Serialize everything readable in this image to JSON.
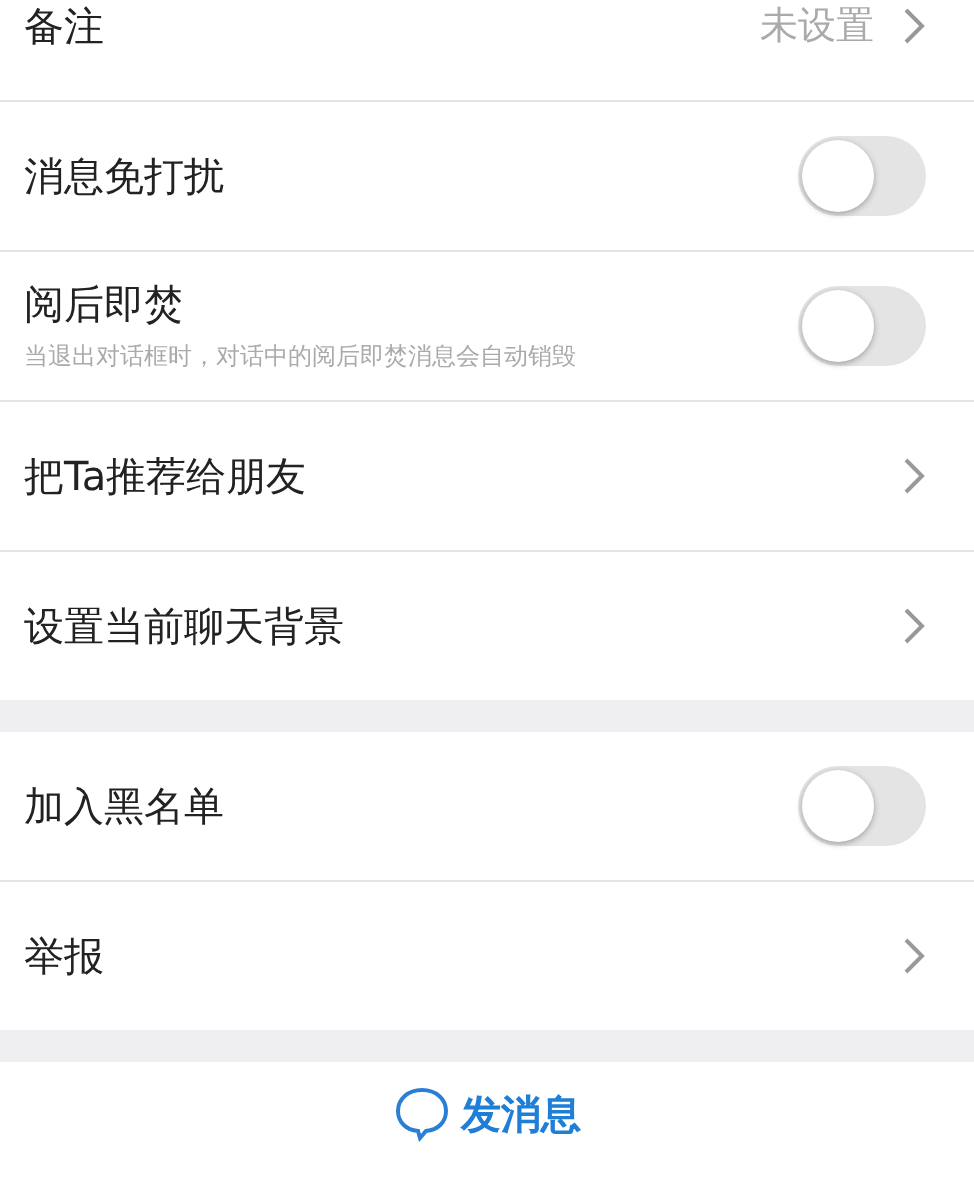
{
  "groups": [
    {
      "items": [
        {
          "kind": "value",
          "label": "备注",
          "value": "未设置"
        },
        {
          "kind": "toggle",
          "label": "消息免打扰",
          "on": false
        },
        {
          "kind": "toggle",
          "label": "阅后即焚",
          "subtitle": "当退出对话框时，对话中的阅后即焚消息会自动销毁",
          "on": false
        },
        {
          "kind": "link",
          "label": "把Ta推荐给朋友"
        },
        {
          "kind": "link",
          "label": "设置当前聊天背景"
        }
      ]
    },
    {
      "items": [
        {
          "kind": "toggle",
          "label": "加入黑名单",
          "on": false
        },
        {
          "kind": "link",
          "label": "举报"
        }
      ]
    }
  ],
  "bottom_button": {
    "label": "发消息"
  }
}
